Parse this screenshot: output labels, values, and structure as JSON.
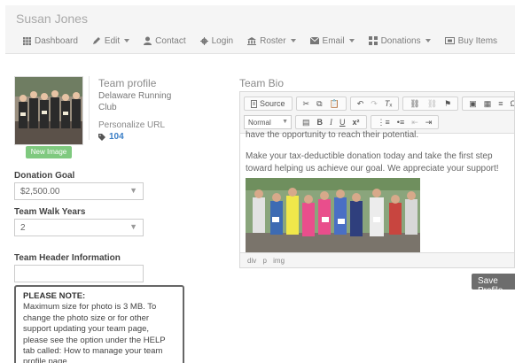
{
  "header": {
    "user_name": "Susan Jones",
    "nav": [
      {
        "label": "Dashboard",
        "icon": "grid-icon",
        "dropdown": false
      },
      {
        "label": "Edit",
        "icon": "pencil-icon",
        "dropdown": true
      },
      {
        "label": "Contact",
        "icon": "user-icon",
        "dropdown": false
      },
      {
        "label": "Login",
        "icon": "gear-icon",
        "dropdown": false
      },
      {
        "label": "Roster",
        "icon": "building-icon",
        "dropdown": true
      },
      {
        "label": "Email",
        "icon": "envelope-icon",
        "dropdown": true
      },
      {
        "label": "Donations",
        "icon": "coins-icon",
        "dropdown": true
      },
      {
        "label": "Buy Items",
        "icon": "ticket-icon",
        "dropdown": false
      }
    ]
  },
  "profile": {
    "heading": "Team profile",
    "team_name": "Delaware Running Club",
    "personalize_label": "Personalize URL",
    "url_id": "104",
    "new_image_label": "New Image"
  },
  "form": {
    "donation_goal_label": "Donation Goal",
    "donation_goal_value": "$2,500.00",
    "team_walk_years_label": "Team Walk Years",
    "team_walk_years_value": "2",
    "team_header_label": "Team Header Information",
    "team_header_value": ""
  },
  "note": {
    "title": "PLEASE NOTE:",
    "text": "Maximum size for photo is 3 MB. To change the photo size or for other support updating your team page, please see the option under the HELP tab called: How to manage your team profile page."
  },
  "bio": {
    "heading": "Team Bio",
    "toolbar": {
      "source_label": "Source",
      "format_value": "Normal",
      "bold": "B",
      "italic": "I",
      "underline": "U",
      "superscript": "x²"
    },
    "cut_line": "have the opportunity to reach their potential.",
    "paragraph": "Make your tax-deductible donation today and take the first step toward helping us achieve our goal. We appreciate your support!",
    "status_path": [
      "div",
      "p",
      "img"
    ]
  },
  "actions": {
    "save_label": "Save Profile"
  },
  "colors": {
    "link_blue": "#3a7ec6",
    "new_image_green": "#7fc97f",
    "save_button_gray": "#6d6d6d"
  }
}
